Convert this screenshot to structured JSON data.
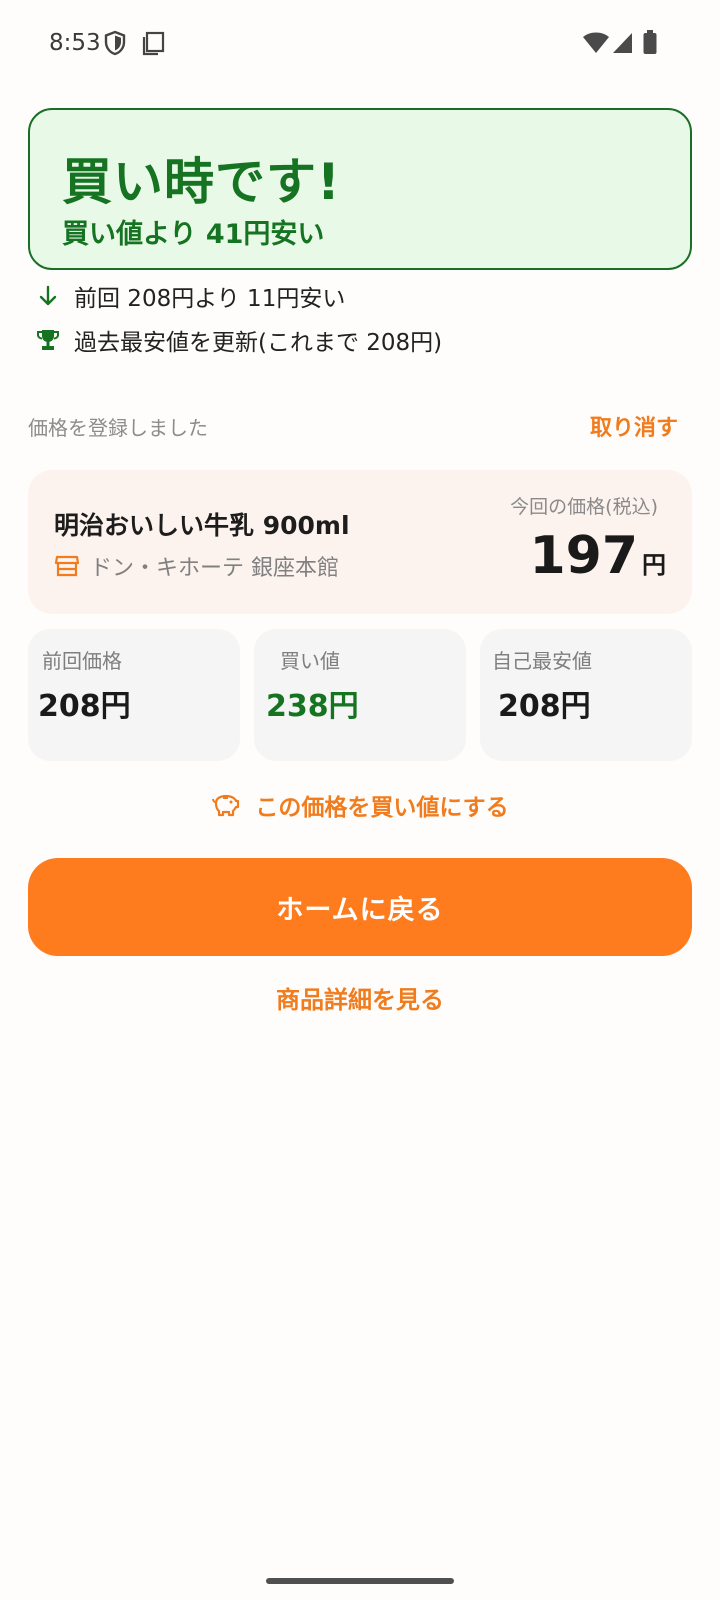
{
  "status_bar": {
    "time": "8:53",
    "icons": [
      "shield-icon",
      "screenshot-icon",
      "wifi-icon",
      "signal-icon",
      "battery-icon"
    ]
  },
  "banner": {
    "title": "買い時です!",
    "subtitle": "買い値より 41円安い"
  },
  "info": {
    "previous_diff": "前回 208円より 11円安い",
    "record_low": "過去最安値を更新(これまで 208円)"
  },
  "registration": {
    "message": "価格を登録しました",
    "cancel_label": "取り消す"
  },
  "product": {
    "name": "明治おいしい牛乳 900ml",
    "store": "ドン・キホーテ 銀座本館",
    "price_label": "今回の価格(税込)",
    "price": "197",
    "price_unit": "円"
  },
  "stats": [
    {
      "label": "前回価格",
      "value": "208円"
    },
    {
      "label": "買い値",
      "value": "238円"
    },
    {
      "label": "自己最安値",
      "value": "208円"
    }
  ],
  "actions": {
    "set_target_label": "この価格を買い値にする",
    "home_label": "ホームに戻る",
    "details_label": "商品詳細を見る"
  },
  "colors": {
    "accent": "#fe7b1e",
    "success_green": "#157321",
    "banner_bg": "#e9f9e8",
    "card_bg": "#fdf3ee"
  }
}
